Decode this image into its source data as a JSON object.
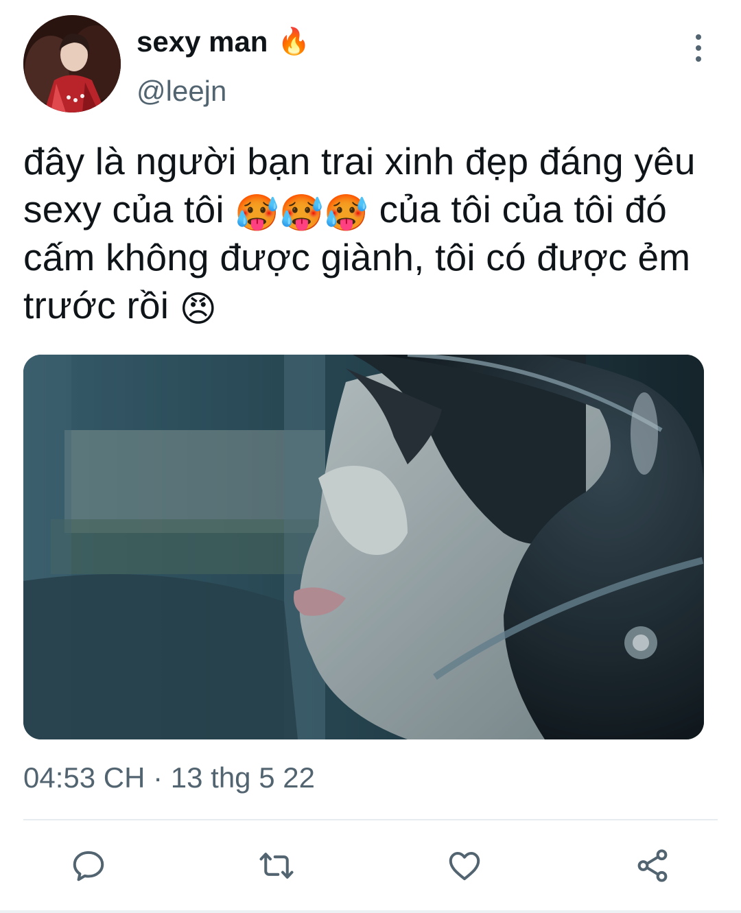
{
  "author": {
    "display_name": "sexy man",
    "name_emoji": "🔥",
    "handle": "@leejn"
  },
  "tweet": {
    "text_part1": "đây là người bạn trai xinh đẹp đáng yêu sexy của tôi ",
    "emoji_hot": "🥵",
    "text_part2": " của tôi của tôi đó cấm không được giành, tôi có được ẻm trước rồi ",
    "emoji_angry": "😠",
    "timestamp": "04:53 CH · 13 thg 5 22"
  },
  "icons": {
    "more": "more-vertical-icon",
    "reply": "reply-icon",
    "retweet": "retweet-icon",
    "like": "heart-icon",
    "share": "share-icon"
  },
  "colors": {
    "text": "#0f1419",
    "secondary": "#536471",
    "divider": "#e6ecf0"
  }
}
